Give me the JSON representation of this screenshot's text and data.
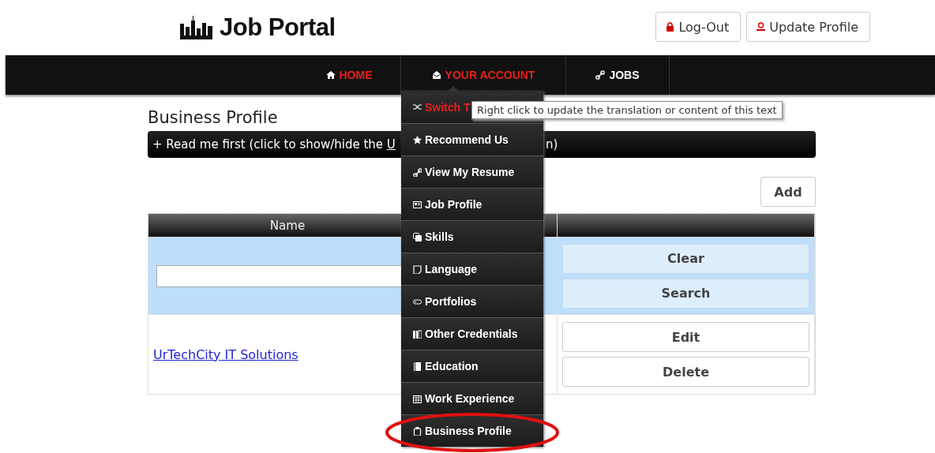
{
  "header": {
    "logo": "Job Portal",
    "buttons": [
      {
        "kind": "lock",
        "label": "Log-Out"
      },
      {
        "kind": "user",
        "label": "Update Profile"
      }
    ]
  },
  "nav": [
    {
      "kind": "home",
      "label": "HOME",
      "highlighted": true
    },
    {
      "kind": "account",
      "label": "YOUR ACCOUNT",
      "highlighted": true
    },
    {
      "kind": "link",
      "label": "JOBS",
      "highlighted": false
    }
  ],
  "account_menu": {
    "items": [
      {
        "label": "Switch T",
        "highlighted": true
      },
      {
        "label": "Recommend Us",
        "highlighted": false
      },
      {
        "label": "View My Resume",
        "highlighted": false
      },
      {
        "label": "Job Profile",
        "highlighted": false
      },
      {
        "label": "Skills",
        "highlighted": false
      },
      {
        "label": "Language",
        "highlighted": false
      },
      {
        "label": "Portfolios",
        "highlighted": false
      },
      {
        "label": "Other Credentials",
        "highlighted": false
      },
      {
        "label": "Education",
        "highlighted": false
      },
      {
        "label": "Work Experience",
        "highlighted": false
      },
      {
        "label": "Business Profile",
        "highlighted": false
      }
    ]
  },
  "tooltip": "Right click to update the translation or content of this text",
  "page": {
    "title": "Business Profile",
    "readme": {
      "text": "+ Read me first (click to show/hide the ",
      "link": "U",
      "tail": "n)"
    },
    "add_button": "Add",
    "table": {
      "columns": [
        "Name"
      ],
      "filter_buttons": [
        "Clear",
        "Search"
      ],
      "rows": [
        {
          "name": "UrTechCity IT Solutions",
          "actions": [
            "Edit",
            "Delete"
          ]
        }
      ]
    }
  },
  "annotation": {
    "kind": "ellipse"
  }
}
